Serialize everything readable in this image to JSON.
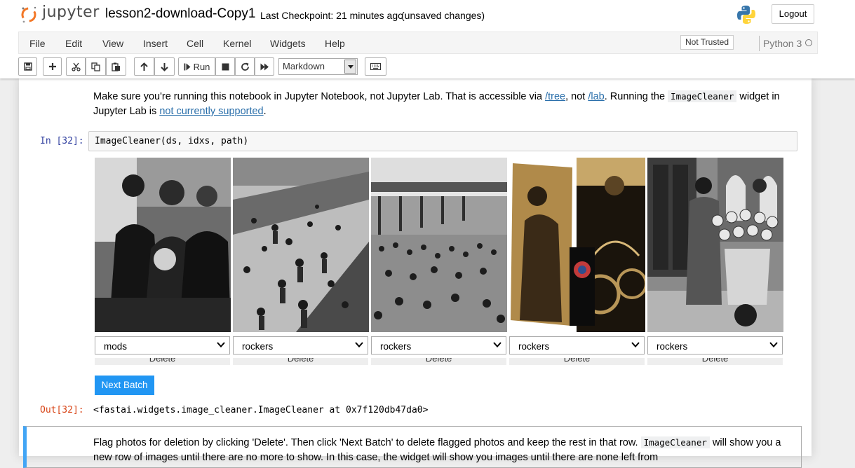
{
  "header": {
    "logo_text": "jupyter",
    "notebook_title": "lesson2-download-Copy1",
    "checkpoint": "Last Checkpoint: 21 minutes ago",
    "autosave_status": "(unsaved changes)",
    "logout_label": "Logout"
  },
  "menubar": {
    "items": [
      "File",
      "Edit",
      "View",
      "Insert",
      "Cell",
      "Kernel",
      "Widgets",
      "Help"
    ],
    "trust_label": "Not Trusted",
    "kernel_name": "Python 3"
  },
  "toolbar": {
    "run_label": "Run",
    "cell_type": "Markdown",
    "icons": [
      "save-icon",
      "plus-icon",
      "cut-icon",
      "copy-icon",
      "paste-icon",
      "arrow-up-icon",
      "arrow-down-icon",
      "step-forward-icon",
      "stop-icon",
      "refresh-icon",
      "fast-forward-icon",
      "keyboard-icon"
    ]
  },
  "cells": {
    "md1": {
      "text_a": "Make sure you're running this notebook in Jupyter Notebook, not Jupyter Lab. That is accessible via ",
      "link_tree": "/tree",
      "text_b": ", not ",
      "link_lab": "/lab",
      "text_c": ". Running the ",
      "code": "ImageCleaner",
      "text_d": " widget in",
      "line2_a": "Jupyter Lab is ",
      "link_support": "not currently supported",
      "line2_b": "."
    },
    "code_cell": {
      "in_prompt": "In [32]:",
      "source": "ImageCleaner(ds, idxs, path)",
      "out_prompt": "Out[32]:",
      "output": "<fastai.widgets.image_cleaner.ImageCleaner at 0x7f120db47da0>"
    },
    "widget": {
      "labels": [
        "mods",
        "rockers",
        "rockers",
        "rockers",
        "rockers"
      ],
      "delete_label": "Delete",
      "next_batch_label": "Next Batch"
    },
    "md2": {
      "text_a": "Flag photos for deletion by clicking 'Delete'. Then click 'Next Batch' to delete flagged photos and keep the rest in that row. ",
      "code": "ImageCleaner",
      "text_b": " will show you a",
      "line2": "new row of images until there are no more to show. In this case, the widget will show you images until there are none left from"
    }
  },
  "colors": {
    "accent_blue": "#2196f3",
    "in_prompt": "#303f9f",
    "out_prompt": "#d84315",
    "selected_border": "#42a5f5",
    "link": "#296eaa"
  }
}
